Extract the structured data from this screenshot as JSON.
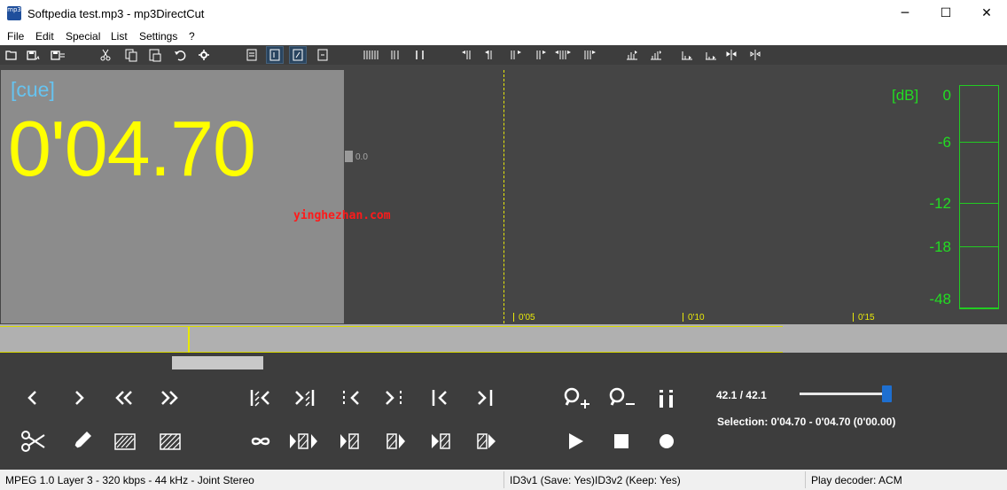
{
  "window": {
    "title": "Softpedia test.mp3 - mp3DirectCut",
    "icon": "mp3",
    "minimize": "─",
    "maximize": "☐",
    "close": "✕"
  },
  "menu": [
    "File",
    "Edit",
    "Special",
    "List",
    "Settings",
    "?"
  ],
  "display": {
    "mode_label": "[cue]",
    "time": "0'04.70",
    "level_value": "0.0",
    "watermark": "yinghezhan.com",
    "time_ticks": [
      "0'05",
      "0'10",
      "0'15"
    ],
    "db_title": "[dB]",
    "db_scale": [
      "0",
      "-6",
      "-12",
      "-18",
      "-48"
    ]
  },
  "zoom": {
    "left_value": "42.1",
    "separator": "/",
    "right_value": "42.1",
    "slider_level": 0.98
  },
  "selection_text": "Selection: 0'04.70 - 0'04.70 (0'00.00)",
  "status": {
    "format": "MPEG 1.0 Layer 3  -  320 kbps  -  44 kHz  -  Joint Stereo",
    "id3v1": "ID3v1 (Save: Yes)",
    "id3v2": "ID3v2 (Keep: Yes)",
    "decoder": "Play decoder: ACM"
  },
  "colors": {
    "time_yellow": "#ffff00",
    "cue_blue": "#66c3f0",
    "meter_green": "#22dd22",
    "watermark_red": "#ff1a1a",
    "slider_blue": "#1e6fd0"
  }
}
